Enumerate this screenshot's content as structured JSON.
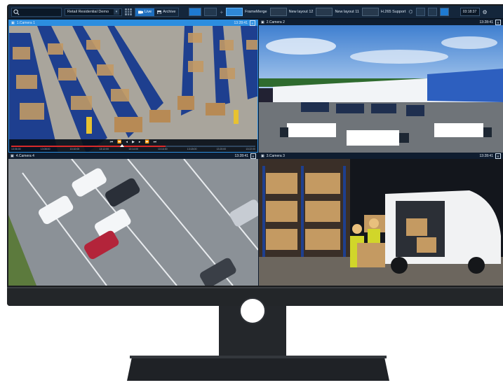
{
  "toolbar": {
    "search_placeholder": "",
    "site_select": "Retail Residential Demo",
    "live_label": "Live",
    "archive_label": "Archive",
    "layouts": [
      {
        "label": "FrameMerge"
      },
      {
        "label": "New layout 12"
      },
      {
        "label": "New layout 11"
      },
      {
        "label": "H.265 Support"
      }
    ],
    "clock": "03:18:37"
  },
  "cameras": [
    {
      "title": "1.Camera 1",
      "time": "13:28:41",
      "active": true,
      "scene": "warehouse-aisles"
    },
    {
      "title": "2.Camera 2",
      "time": "13:28:41",
      "active": false,
      "scene": "logistics-yard"
    },
    {
      "title": "4.Camera 4",
      "time": "13:28:41",
      "active": false,
      "scene": "parking-lot"
    },
    {
      "title": "3.Camera 3",
      "time": "13:28:41",
      "active": false,
      "scene": "loading-van"
    }
  ],
  "timeline": {
    "labels": [
      "13:06:00",
      "13:08:00",
      "13:10:00",
      "13:12:00",
      "13:14:00",
      "13:16:00",
      "13:18:00",
      "13:20:00",
      "13:22:00"
    ]
  },
  "colors": {
    "accent": "#2c8ee0",
    "record": "#d92a2a",
    "toolbar_bg": "#14263b"
  }
}
